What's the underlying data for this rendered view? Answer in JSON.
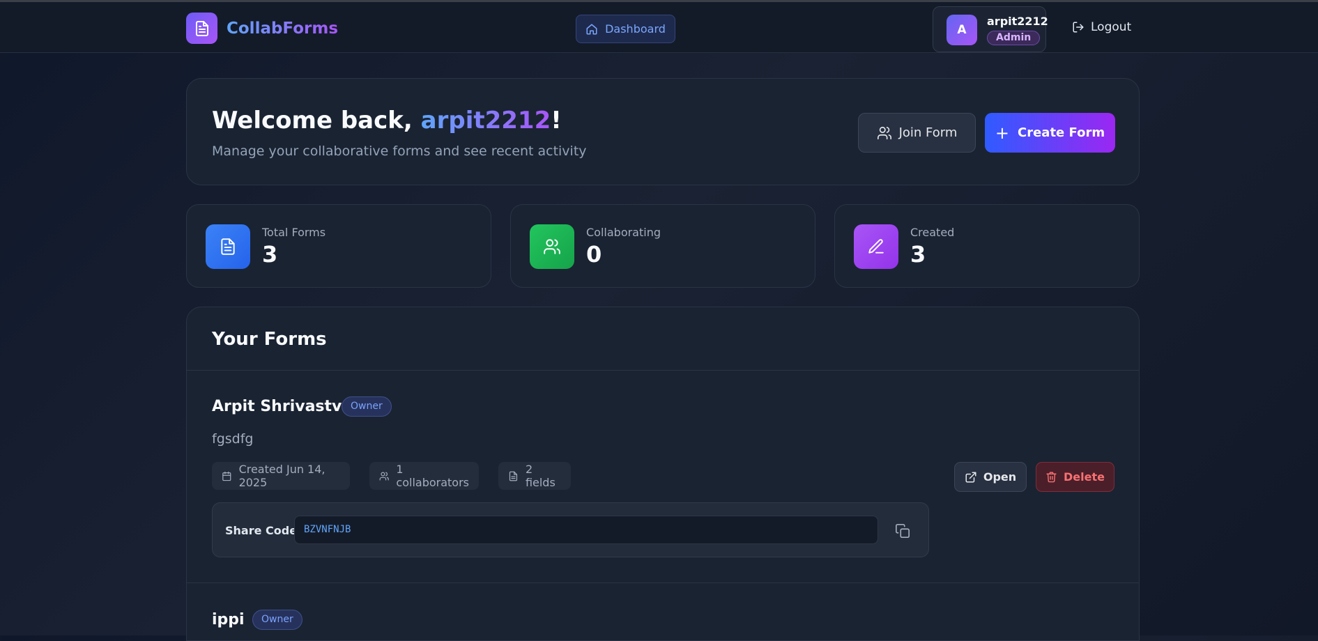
{
  "app": {
    "name": "CollabForms"
  },
  "nav": {
    "dashboard_label": "Dashboard",
    "logout_label": "Logout"
  },
  "user": {
    "avatar_initial": "A",
    "username": "arpit2212",
    "role": "Admin"
  },
  "welcome": {
    "greeting_prefix": "Welcome back, ",
    "username": "arpit2212",
    "greeting_suffix": "!",
    "subtitle": "Manage your collaborative forms and see recent activity",
    "join_label": "Join Form",
    "create_label": "Create Form"
  },
  "stats": [
    {
      "label": "Total Forms",
      "value": "3",
      "icon": "document-icon",
      "color": "#3b82f6"
    },
    {
      "label": "Collaborating",
      "value": "0",
      "icon": "users-icon",
      "color": "#22c55e"
    },
    {
      "label": "Created",
      "value": "3",
      "icon": "pen-icon",
      "color": "#a855f7"
    }
  ],
  "forms_section": {
    "title": "Your Forms",
    "items": [
      {
        "name": "Arpit Shrivastva",
        "badge": "Owner",
        "description": "fgsdfg",
        "created": "Created Jun 14, 2025",
        "collaborators": "1 collaborators",
        "fields": "2 fields",
        "share_label": "Share Code:",
        "share_code": "BZVNFNJB",
        "open_label": "Open",
        "delete_label": "Delete"
      },
      {
        "name": "ippi",
        "badge": "Owner"
      }
    ]
  },
  "colors": {
    "accent_blue": "#2f5bff",
    "accent_purple": "#9b27f2",
    "danger": "#f87171"
  }
}
